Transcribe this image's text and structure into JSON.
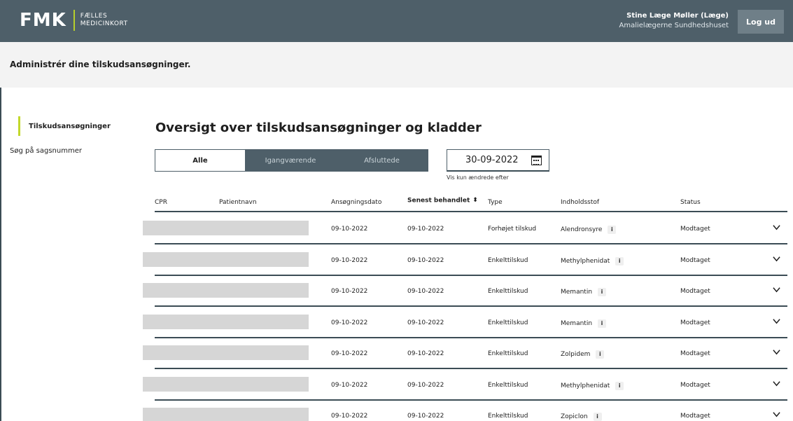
{
  "header": {
    "logo_mark": "FMK",
    "logo_line1": "FÆLLES",
    "logo_line2": "MEDICINKORT",
    "user_name": "Stine Læge Møller (Læge)",
    "user_org": "Amalielægerne Sundhedshuset",
    "logout_label": "Log ud"
  },
  "banner": {
    "title": "Administrér dine tilskudsansøgninger."
  },
  "sidebar": {
    "items": [
      {
        "label": "Tilskudsansøgninger",
        "active": true
      },
      {
        "label": "Søg på sagsnummer",
        "active": false
      }
    ]
  },
  "main": {
    "title": "Oversigt over tilskudsansøgninger og kladder",
    "filters": {
      "all": "Alle",
      "ongoing": "Igangværende",
      "done": "Afsluttede"
    },
    "date": {
      "value": "30-09-2022",
      "help": "Vis kun ændrede efter"
    }
  },
  "table": {
    "columns": [
      "CPR",
      "Patientnavn",
      "Ansøgningsdato",
      "Senest behandlet",
      "Type",
      "Indholdsstof",
      "Status"
    ],
    "rows": [
      {
        "applied": "09-10-2022",
        "handled": "09-10-2022",
        "type": "Forhøjet tilskud",
        "substance": "Alendronsyre",
        "status": "Modtaget"
      },
      {
        "applied": "09-10-2022",
        "handled": "09-10-2022",
        "type": "Enkelttilskud",
        "substance": "Methylphenidat",
        "status": "Modtaget"
      },
      {
        "applied": "09-10-2022",
        "handled": "09-10-2022",
        "type": "Enkelttilskud",
        "substance": "Memantin",
        "status": "Modtaget"
      },
      {
        "applied": "09-10-2022",
        "handled": "09-10-2022",
        "type": "Enkelttilskud",
        "substance": "Memantin",
        "status": "Modtaget"
      },
      {
        "applied": "09-10-2022",
        "handled": "09-10-2022",
        "type": "Enkelttilskud",
        "substance": "Zolpidem",
        "status": "Modtaget"
      },
      {
        "applied": "09-10-2022",
        "handled": "09-10-2022",
        "type": "Enkelttilskud",
        "substance": "Methylphenidat",
        "status": "Modtaget"
      },
      {
        "applied": "09-10-2022",
        "handled": "09-10-2022",
        "type": "Enkelttilskud",
        "substance": "Zopiclon",
        "status": "Modtaget"
      }
    ]
  },
  "colors": {
    "header_bg": "#4e5f69",
    "accent": "#c2d82b",
    "banner_bg": "#f3f3f3"
  }
}
